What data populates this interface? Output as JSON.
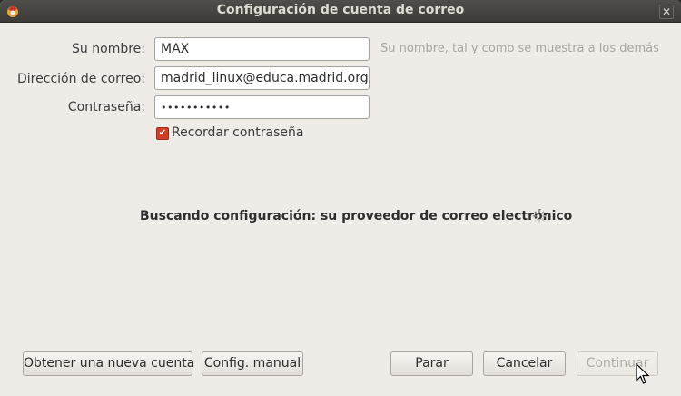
{
  "window": {
    "title": "Configuración de cuenta de correo"
  },
  "form": {
    "name_label": "Su nombre:",
    "name_value": "MAX",
    "name_hint": "Su nombre, tal y como se muestra a los demás",
    "email_label": "Dirección de correo:",
    "email_value": "madrid_linux@educa.madrid.org",
    "password_label": "Contraseña:",
    "password_value": "•••••••••••",
    "remember_label": "Recordar contraseña",
    "remember_checked": true
  },
  "status": {
    "text": "Buscando configuración: su proveedor de correo electrónico"
  },
  "buttons": {
    "new_account": "Obtener una nueva cuenta",
    "manual_config": "Config. manual",
    "stop": "Parar",
    "cancel": "Cancelar",
    "continue": "Continuar"
  },
  "icons": {
    "app": "thunderbird-icon",
    "close": "close-icon",
    "spinner": "loading-spinner-icon",
    "check": "check-icon"
  },
  "colors": {
    "titlebar": "#3c3b37",
    "window_bg": "#efebe7",
    "checkbox_accent": "#d03f2a"
  }
}
